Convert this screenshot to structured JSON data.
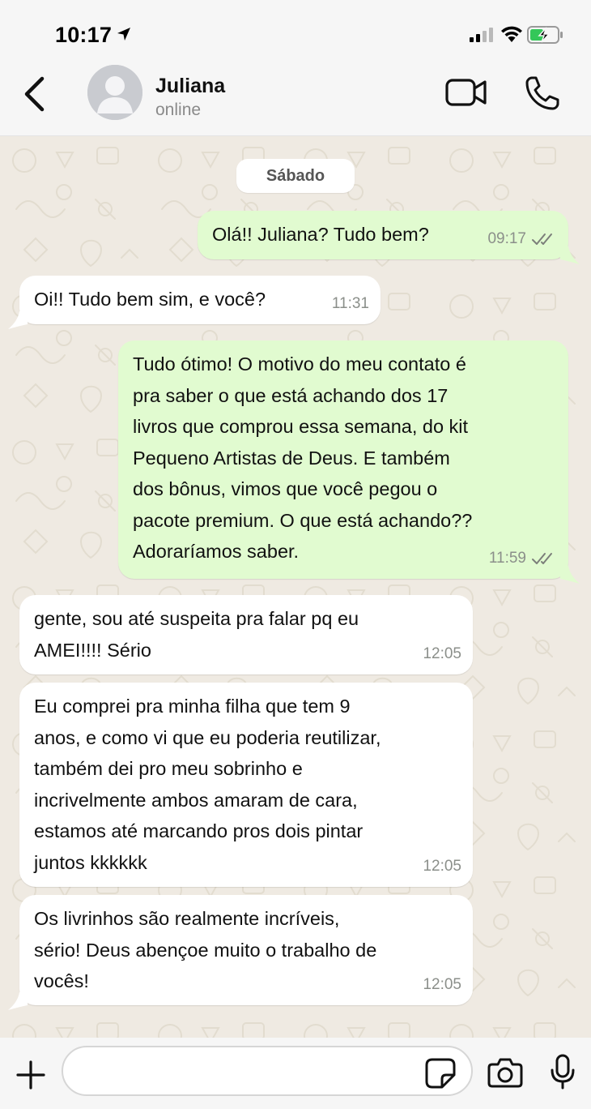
{
  "status_bar": {
    "time": "10:17",
    "icons": [
      "location-arrow-icon",
      "signal-icon",
      "wifi-icon",
      "battery-charging-icon"
    ],
    "battery_color": "#34c759"
  },
  "header": {
    "back_icon": "chevron-left-icon",
    "contact_name": "Juliana",
    "contact_status": "online",
    "actions": [
      "video-call-icon",
      "phone-call-icon"
    ]
  },
  "chat": {
    "date_label": "Sábado",
    "outgoing_color": "#e1fbd0",
    "incoming_color": "#ffffff",
    "messages": [
      {
        "direction": "outgoing",
        "text": "Olá!! Juliana? Tudo bem?",
        "time": "09:17",
        "status": "read-double-check"
      },
      {
        "direction": "incoming",
        "text": "Oi!! Tudo bem sim, e você?",
        "time": "11:31"
      },
      {
        "direction": "outgoing",
        "text": "Tudo ótimo! O motivo do meu contato é\npra saber o que está achando dos 17\nlivros que comprou essa semana, do kit\nPequeno Artistas de Deus. E também\ndos bônus, vimos que você pegou o\npacote premium. O que está achando??\nAdoraríamos saber.",
        "time": "11:59",
        "status": "read-double-check"
      },
      {
        "direction": "incoming",
        "text": "gente, sou até suspeita pra falar pq eu\nAMEI!!!! Sério",
        "time": "12:05"
      },
      {
        "direction": "incoming",
        "text": "Eu comprei pra minha filha que tem 9\nanos, e como vi que eu poderia reutilizar,\ntambém  dei pro meu sobrinho e\nincrivelmente ambos amaram de cara,\nestamos até marcando pros dois pintar\njuntos kkkkkk",
        "time": "12:05"
      },
      {
        "direction": "incoming",
        "text": "Os livrinhos são realmente incríveis,\nsério! Deus abençoe muito o trabalho de\nvocês!",
        "time": "12:05"
      }
    ]
  },
  "input_bar": {
    "attach_icon": "plus-icon",
    "message_value": "",
    "placeholder": "",
    "icons": [
      "sticker-icon",
      "camera-icon",
      "microphone-icon"
    ]
  }
}
